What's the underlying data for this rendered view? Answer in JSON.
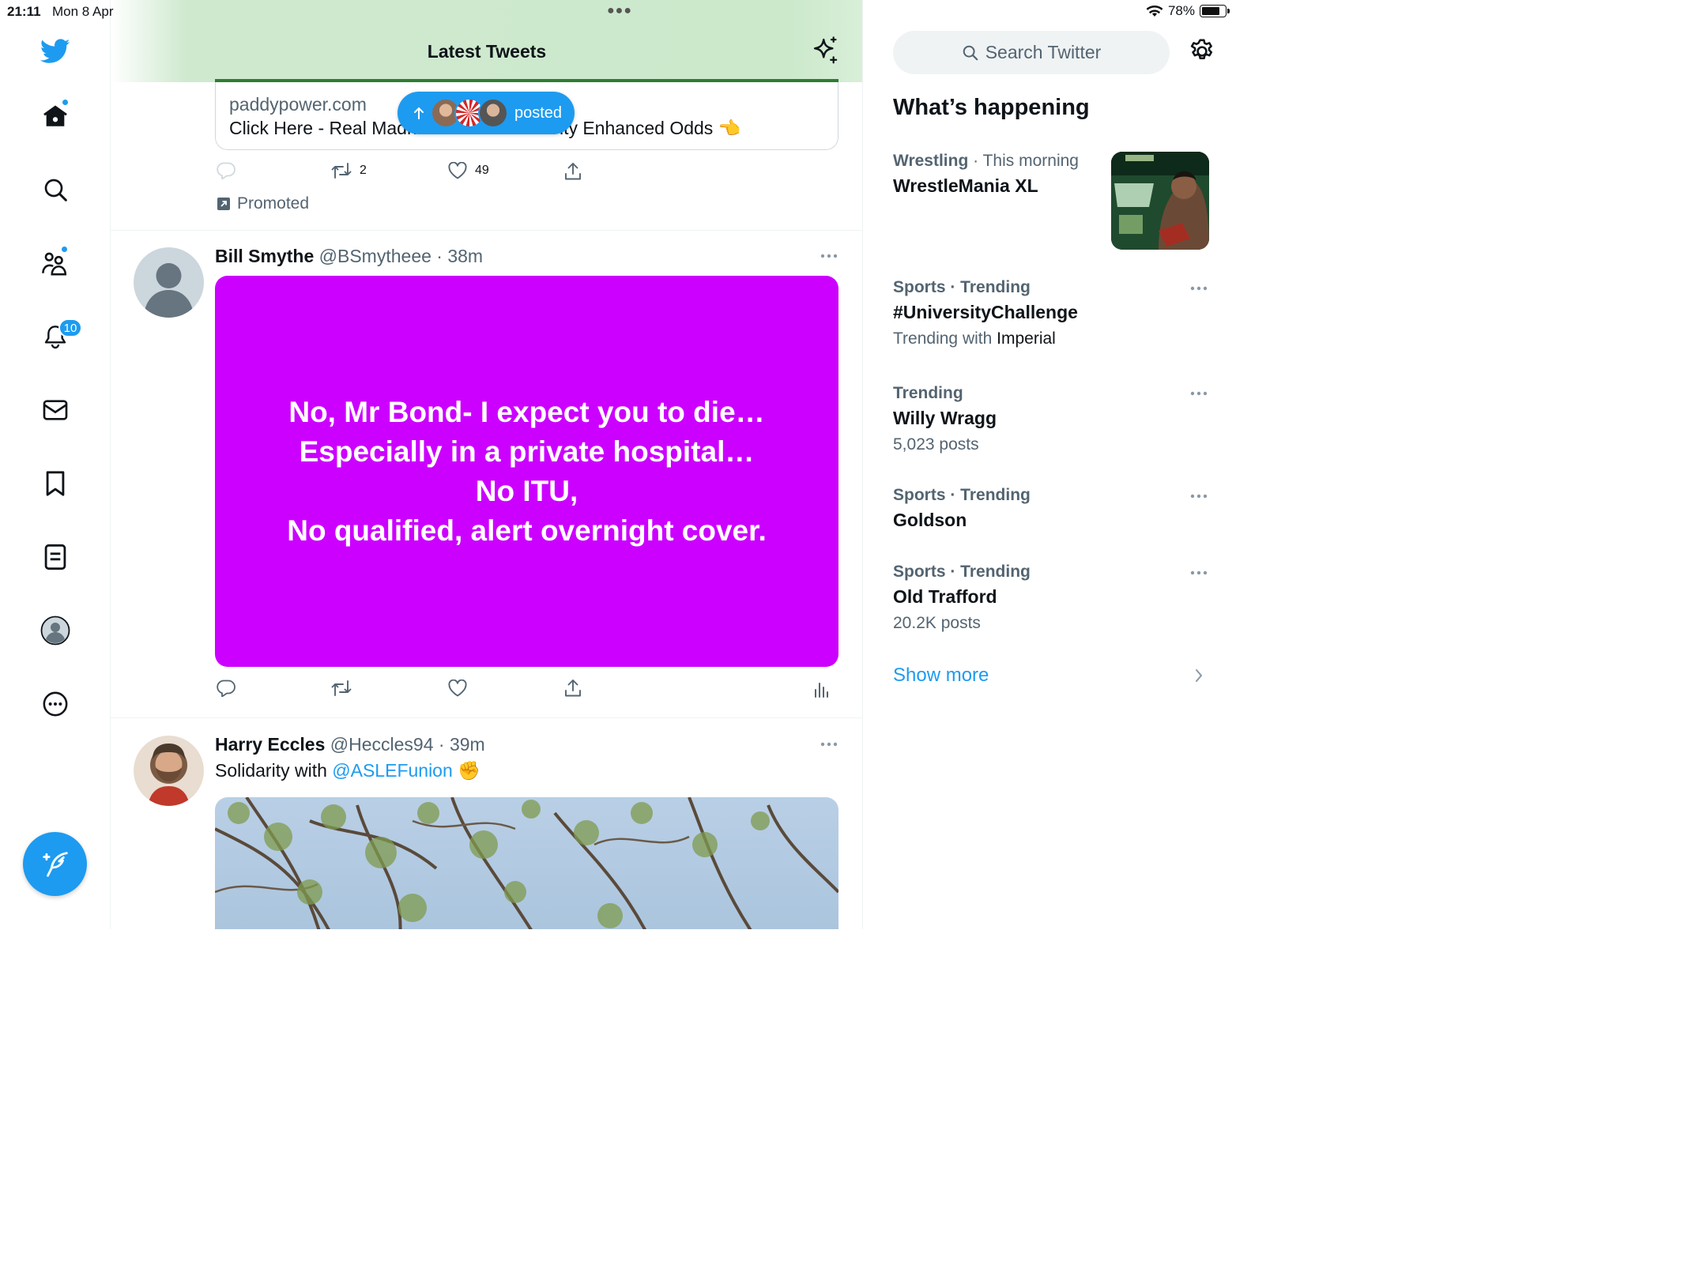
{
  "status_bar": {
    "time": "21:11",
    "date": "Mon 8 Apr",
    "battery": "78%",
    "battery_level": 0.78
  },
  "nav": {
    "notifications_badge": "10"
  },
  "timeline": {
    "title": "Latest Tweets",
    "new_posts_pill": {
      "label": "posted"
    },
    "promo": {
      "domain": "paddypower.com",
      "card_title": "Click Here - Real Madrid v Manchester City Enhanced Odds 👈",
      "retweets": "2",
      "likes": "49",
      "promoted_label": "Promoted"
    },
    "tweets": [
      {
        "name": "Bill Smythe",
        "handle": "@BSmytheee",
        "time": "· 38m",
        "image_text": [
          "No, Mr Bond- I expect you to die…",
          "Especially in a private hospital…",
          "No ITU,",
          "No qualified, alert overnight cover."
        ]
      },
      {
        "name": "Harry Eccles",
        "handle": "@Heccles94",
        "time": "· 39m",
        "text": "Solidarity with",
        "mention": "@ASLEFunion",
        "emoji": "✊"
      }
    ]
  },
  "sidebar": {
    "search_placeholder": "Search Twitter",
    "heading": "What’s happening",
    "trends": [
      {
        "category": "Wrestling",
        "context": "· This morning",
        "name": "WrestleMania XL"
      },
      {
        "category": "Sports",
        "context": "· Trending",
        "name": "#UniversityChallenge",
        "sub_prefix": "Trending with",
        "sub_value": "Imperial"
      },
      {
        "category": "Trending",
        "context": "",
        "name": "Willy Wragg",
        "sub": "5,023 posts"
      },
      {
        "category": "Sports",
        "context": "· Trending",
        "name": "Goldson"
      },
      {
        "category": "Sports",
        "context": "· Trending",
        "name": "Old Trafford",
        "sub": "20.2K posts"
      }
    ],
    "show_more": "Show more"
  },
  "colors": {
    "accent": "#1d9bf0",
    "purple_media": "#cc00ff",
    "header_green": "#cce9cc"
  }
}
